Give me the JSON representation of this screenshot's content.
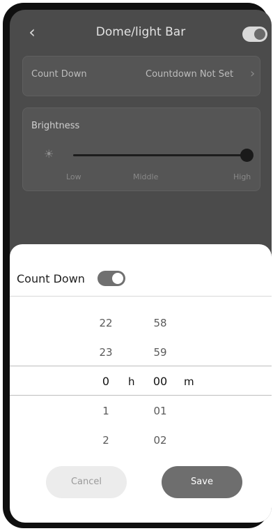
{
  "header": {
    "back_glyph": "‹",
    "title": "Dome/light Bar",
    "power_toggle_on": true
  },
  "countdown_row": {
    "label": "Count Down",
    "value": "Countdown Not Set",
    "chevron_glyph": "›"
  },
  "brightness": {
    "label": "Brightness",
    "icon_glyph": "☀",
    "level_fraction": 1.0,
    "scale_low": "Low",
    "scale_middle": "Middle",
    "scale_high": "High"
  },
  "sheet": {
    "toggle_label": "Count Down",
    "toggle_on": true,
    "hours": [
      "22",
      "23",
      "0",
      "1",
      "2"
    ],
    "minutes": [
      "58",
      "59",
      "00",
      "01",
      "02"
    ],
    "hour_unit": "h",
    "minute_unit": "m",
    "cancel_label": "Cancel",
    "save_label": "Save"
  },
  "colors": {
    "overlay_dark": "#4b4b4b",
    "sheet_bg": "#ffffff",
    "save_button": "#6e6e6e",
    "cancel_button": "#ececec"
  }
}
